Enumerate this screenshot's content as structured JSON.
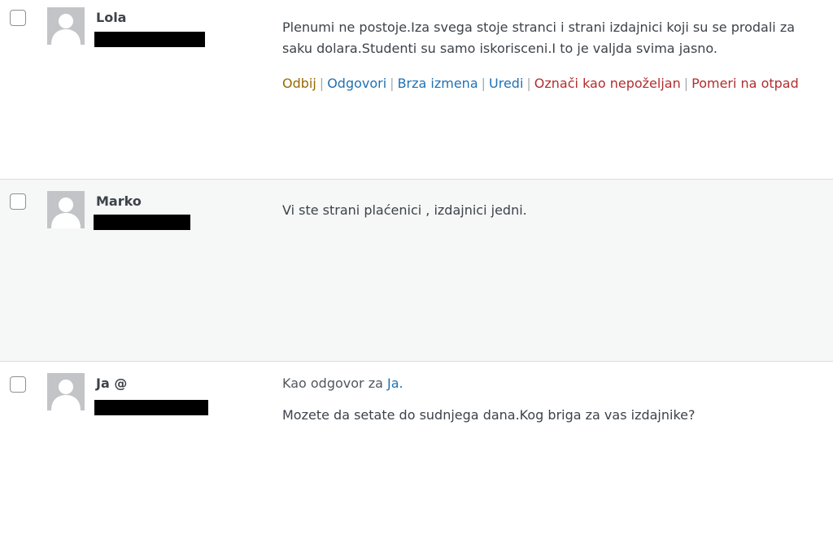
{
  "comments": [
    {
      "author": "Lola",
      "text_lines": [
        "Plenumi ne postoje.Iza svega stoje stranci i strani izdajnici koji su se prodali za",
        "saku dolara.Studenti su samo iskorisceni.I to je valjda svima jasno."
      ],
      "actions": [
        "Odbij",
        "Odgovori",
        "Brza izmena",
        "Uredi",
        "Označi kao nepoželjan",
        "Pomeri na otpad"
      ]
    },
    {
      "author": "Marko",
      "text_lines": [
        "Vi ste strani plaćenici , izdajnici jedni."
      ]
    },
    {
      "author": "Ja @",
      "reply_prefix": "Kao odgovor za",
      "reply_target": "Ja.",
      "text_lines": [
        "Mozete da setate do sudnjega dana.Kog briga za vas izdajnike?"
      ]
    }
  ],
  "icons": {
    "avatar": "default-avatar-icon",
    "checkbox": "checkbox-icon"
  },
  "colors": {
    "approve": "#996800",
    "link": "#2271b1",
    "danger": "#b32d2e",
    "alt_row_bg": "#f6f7f7"
  }
}
